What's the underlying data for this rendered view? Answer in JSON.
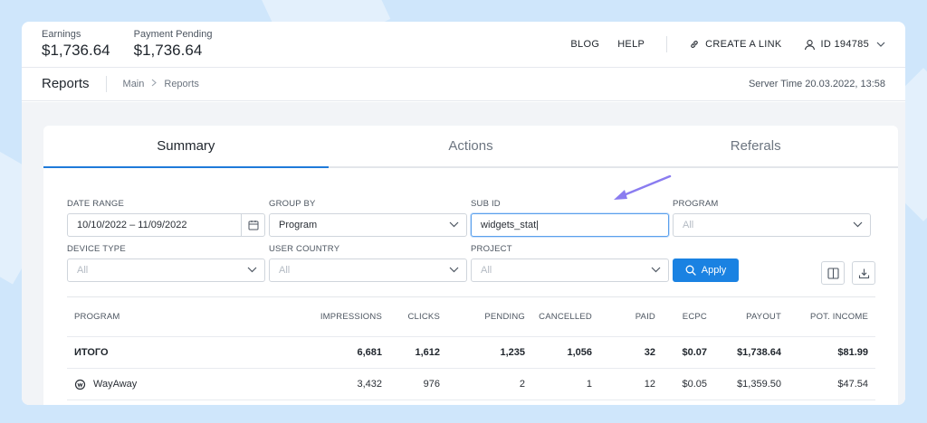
{
  "stats": [
    {
      "label": "Earnings",
      "value": "$1,736.64"
    },
    {
      "label": "Payment Pending",
      "value": "$1,736.64"
    }
  ],
  "topnav": {
    "blog": "BLOG",
    "help": "HELP",
    "create_link": "CREATE A LINK",
    "user_id": "ID 194785"
  },
  "subbar": {
    "title": "Reports",
    "breadcrumb": [
      "Main",
      "Reports"
    ],
    "server_time": "Server Time 20.03.2022, 13:58"
  },
  "tabs": [
    "Summary",
    "Actions",
    "Referals"
  ],
  "filters": {
    "date_range": {
      "label": "DATE RANGE",
      "value": "10/10/2022 – 11/09/2022"
    },
    "group_by": {
      "label": "GROUP BY",
      "value": "Program"
    },
    "sub_id": {
      "label": "SUB ID",
      "value": "widgets_stat|"
    },
    "program": {
      "label": "PROGRAM",
      "placeholder": "All"
    },
    "device_type": {
      "label": "DEVICE TYPE",
      "placeholder": "All"
    },
    "user_country": {
      "label": "USER COUNTRY",
      "placeholder": "All"
    },
    "project": {
      "label": "PROJECT",
      "placeholder": "All"
    },
    "apply": "Apply"
  },
  "table": {
    "headers": [
      "PROGRAM",
      "IMPRESSIONS",
      "CLICKS",
      "PENDING",
      "CANCELLED",
      "PAID",
      "ECPC",
      "PAYOUT",
      "POT. INCOME"
    ],
    "total": [
      "ИТОГО",
      "6,681",
      "1,612",
      "1,235",
      "1,056",
      "32",
      "$0.07",
      "$1,738.64",
      "$81.99"
    ],
    "rows": [
      [
        "WayAway",
        "3,432",
        "976",
        "2",
        "1",
        "12",
        "$0.05",
        "$1,359.50",
        "$47.54"
      ]
    ]
  },
  "colors": {
    "accent": "#1a82e2",
    "arrow": "#8a7cf0"
  }
}
